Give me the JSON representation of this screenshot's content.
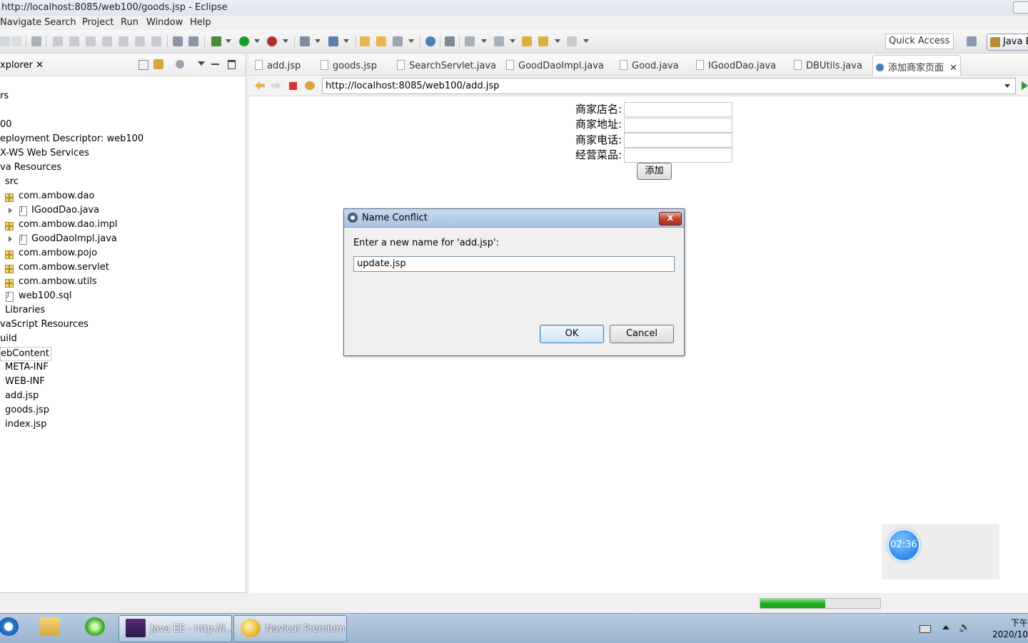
{
  "window": {
    "title": "http://localhost:8085/web100/goods.jsp - Eclipse"
  },
  "menu": [
    "Navigate",
    "Search",
    "Project",
    "Run",
    "Window",
    "Help"
  ],
  "toolbar": {
    "quick_access": "Quick Access",
    "perspective": "Java E"
  },
  "explorer": {
    "tab": "xplorer",
    "items": [
      "rs",
      "00",
      "eployment Descriptor: web100",
      "X-WS Web Services",
      "va Resources",
      "src",
      "com.ambow.dao",
      "IGoodDao.java",
      "com.ambow.dao.impl",
      "GoodDaoImpl.java",
      "com.ambow.pojo",
      "com.ambow.servlet",
      "com.ambow.utils",
      "web100.sql",
      "Libraries",
      "vaScript Resources",
      "uild",
      "ebContent",
      "META-INF",
      "WEB-INF",
      "add.jsp",
      "goods.jsp",
      "index.jsp"
    ]
  },
  "editor": {
    "tabs": [
      "add.jsp",
      "goods.jsp",
      "SearchServlet.java",
      "GoodDaoImpl.java",
      "Good.java",
      "IGoodDao.java",
      "DBUtils.java",
      "添加商家页面"
    ],
    "url": "http://localhost:8085/web100/add.jsp"
  },
  "form": {
    "labels": [
      "商家店名:",
      "商家地址:",
      "商家电话:",
      "经营菜品:"
    ],
    "add_button": "添加"
  },
  "dialog": {
    "title": "Name Conflict",
    "prompt": "Enter a new name for 'add.jsp':",
    "value": "update.jsp",
    "ok": "OK",
    "cancel": "Cancel",
    "close": "x"
  },
  "timer": "02:36",
  "progress": 0.54,
  "taskbar": {
    "items": [
      "Java EE - http://l...",
      "Navicat Premium"
    ],
    "clock_time": "下午",
    "clock_date": "2020/10"
  },
  "colors": {
    "progress": "#1fb01f",
    "close_button": "#c2452d",
    "timer": "#2e8ae8"
  }
}
